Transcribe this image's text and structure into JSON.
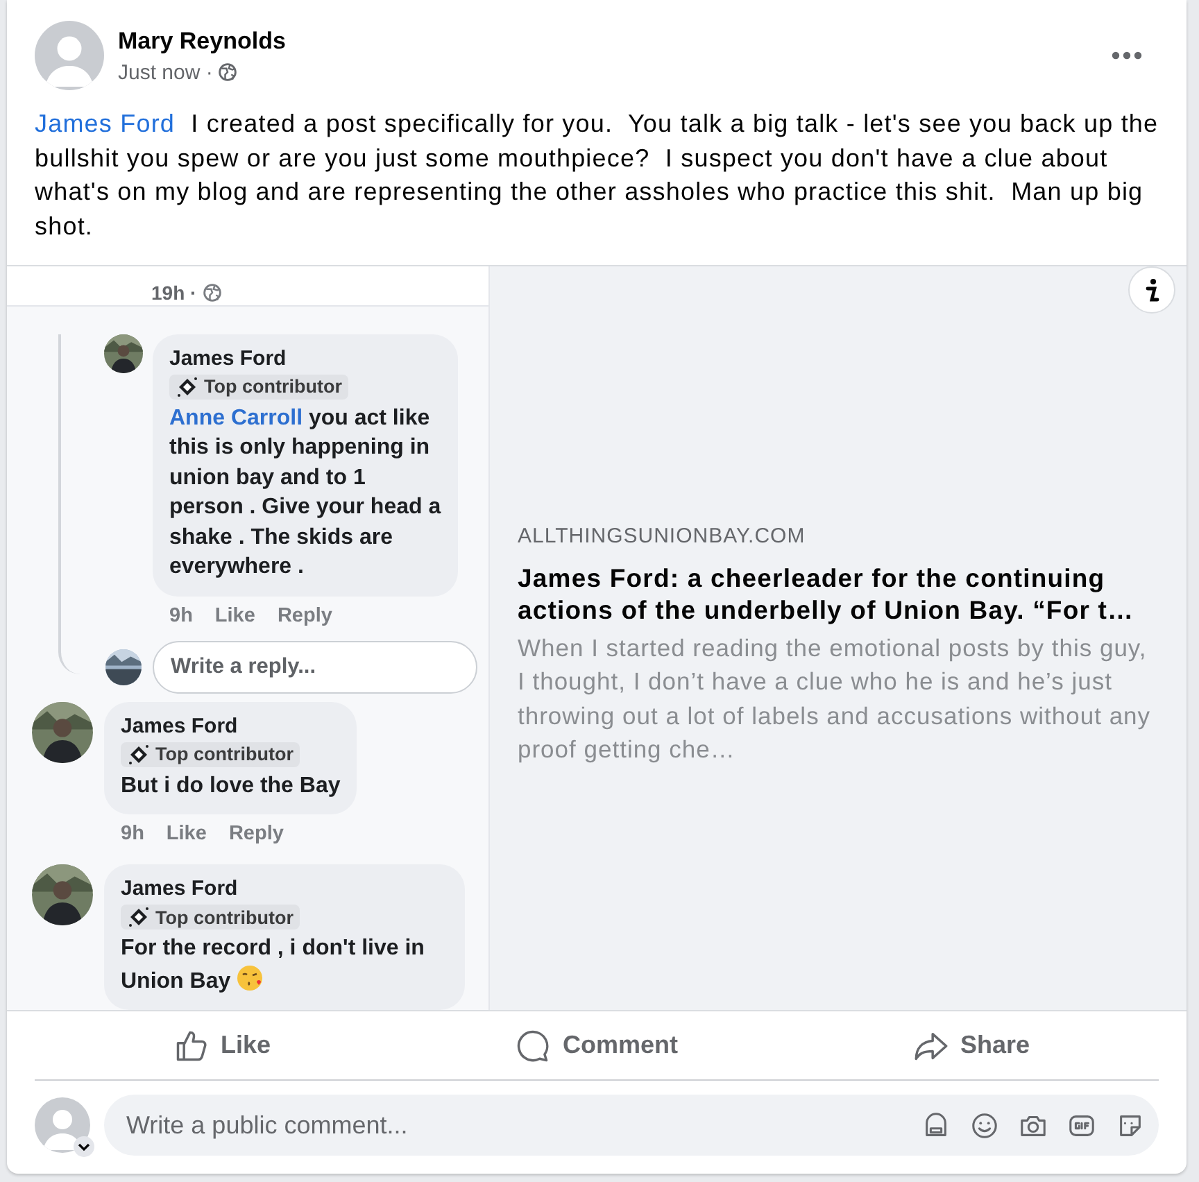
{
  "post": {
    "author": "Mary Reynolds",
    "time": "Just now ·",
    "mention": "James Ford",
    "text": "I created a post specifically for you.  You talk a big talk - let's see you back up the bullshit you spew or are you just some mouthpiece?  I suspect you don't have a clue about what's on my blog and are representing the other assholes who practice this shit.  Man up big shot."
  },
  "link_preview": {
    "domain": "ALLTHINGSUNIONBAY.COM",
    "title": "James Ford: a cheerleader for the continuing actions of the underbelly of Union Bay. “For t…",
    "description": "When I started reading the emotional posts by this guy, I thought, I don’t have a clue who he is and he’s just throwing out a lot of labels and accusations without any proof getting che…",
    "screenshot": {
      "top_time": "19h ·",
      "replies": [
        {
          "author": "James Ford",
          "badge": "Top contributor",
          "mention": "Anne Carroll",
          "text": "you act like this is only happening in union bay and to 1 person . Give your head a shake . The skids are everywhere .",
          "time": "9h",
          "actions": [
            "Like",
            "Reply"
          ]
        }
      ],
      "reply_placeholder": "Write a reply...",
      "comments": [
        {
          "author": "James Ford",
          "badge": "Top contributor",
          "text": "But i do love the Bay",
          "time": "9h",
          "actions": [
            "Like",
            "Reply"
          ]
        },
        {
          "author": "James Ford",
          "badge": "Top contributor",
          "text": "For the record  , i don't live in Union Bay",
          "kiss": true
        }
      ]
    }
  },
  "actions": [
    {
      "kind": "like",
      "label": "Like"
    },
    {
      "kind": "comment",
      "label": "Comment"
    },
    {
      "kind": "share",
      "label": "Share"
    }
  ],
  "comment_box": {
    "placeholder": "Write a public comment..."
  }
}
